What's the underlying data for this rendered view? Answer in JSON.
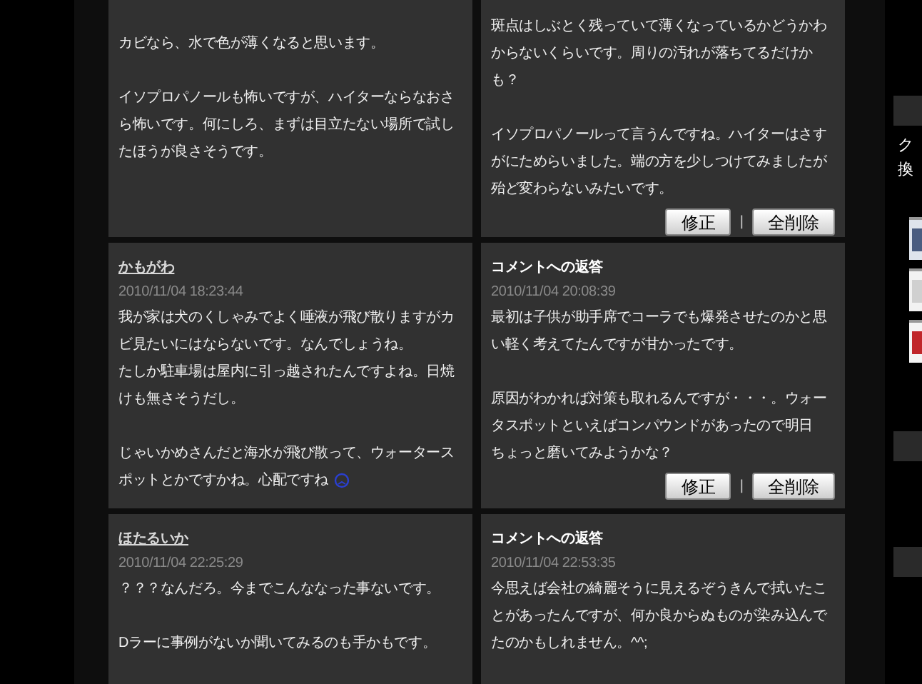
{
  "rows": [
    {
      "comment": {
        "paragraphs": [
          [
            "カビなら、水で色が薄くなると思います。"
          ],
          [
            "イソプロパノールも怖いですが、ハイターならなおさら怖いです。何にしろ、まずは目立たない場所で試したほうが良さそうです。"
          ]
        ]
      },
      "reply": {
        "paragraphs": [
          [
            "斑点はしぶとく残っていて薄くなっているかどうかわからないくらいです。周りの汚れが落ちてるだけかも？"
          ],
          [
            "イソプロパノールって言うんですね。ハイターはさすがにためらいました。端の方を少しつけてみましたが殆ど変わらないみたいです。"
          ]
        ],
        "buttons": [
          "修正",
          "全削除"
        ],
        "separator": "|"
      }
    },
    {
      "comment": {
        "author": "かもがわ",
        "date": "2010/11/04 18:23:44",
        "paragraphs": [
          [
            "我が家は犬のくしゃみでよく唾液が飛び散りますがカビ見たいにはならないです。なんでしょうね。",
            "たしか駐車場は屋内に引っ越されたんですよね。日焼けも無さそうだし。"
          ],
          [
            "じゃいかめさんだと海水が飛び散って、ウォータースポットとかですかね。心配ですね"
          ]
        ],
        "emoticon": true
      },
      "reply": {
        "title": "コメントへの返答",
        "date": "2010/11/04 20:08:39",
        "paragraphs": [
          [
            "最初は子供が助手席でコーラでも爆発させたのかと思い軽く考えてたんですが甘かったです。"
          ],
          [
            "原因がわかれば対策も取れるんですが・・・。ウォータスポットといえばコンパウンドがあったので明日",
            "ちょっと磨いてみようかな？"
          ]
        ],
        "buttons": [
          "修正",
          "全削除"
        ],
        "separator": "|"
      }
    },
    {
      "comment": {
        "author": "ほたるいか",
        "date": "2010/11/04 22:25:29",
        "paragraphs": [
          [
            "？？？なんだろ。今までこんななった事ないです。"
          ],
          [
            "Dラーに事例がないか聞いてみるのも手かもです。"
          ]
        ]
      },
      "reply": {
        "title": "コメントへの返答",
        "date": "2010/11/04 22:53:35",
        "paragraphs": [
          [
            "今思えば会社の綺麗そうに見えるぞうきんで拭いたことがあったんですが、何か良からぬものが染み込んでたのかもしれません。^^;"
          ]
        ]
      }
    }
  ],
  "sidebar": {
    "texts": [
      "ク",
      "換"
    ]
  }
}
